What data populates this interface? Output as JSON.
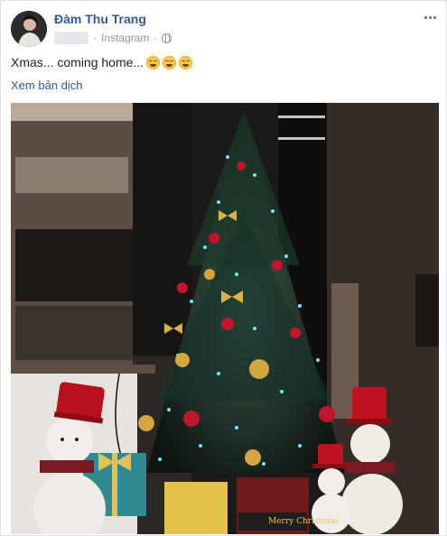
{
  "post": {
    "author": "Đàm Thu Trang",
    "source": "Instagram",
    "privacy_icon": "globe-icon",
    "text": "Xmas... coming home...",
    "emojis": [
      "grinning-squinting-face-icon",
      "grinning-squinting-face-icon",
      "grinning-squinting-face-icon"
    ],
    "translate_link": "Xem bản dịch",
    "more_icon": "more-options-icon"
  },
  "photo": {
    "sign_text": "Merry Christmas"
  },
  "colors": {
    "author_link": "#365899",
    "meta_text": "#90949c",
    "body_text": "#1d2129",
    "tree_lights": "#6fe8ff"
  }
}
